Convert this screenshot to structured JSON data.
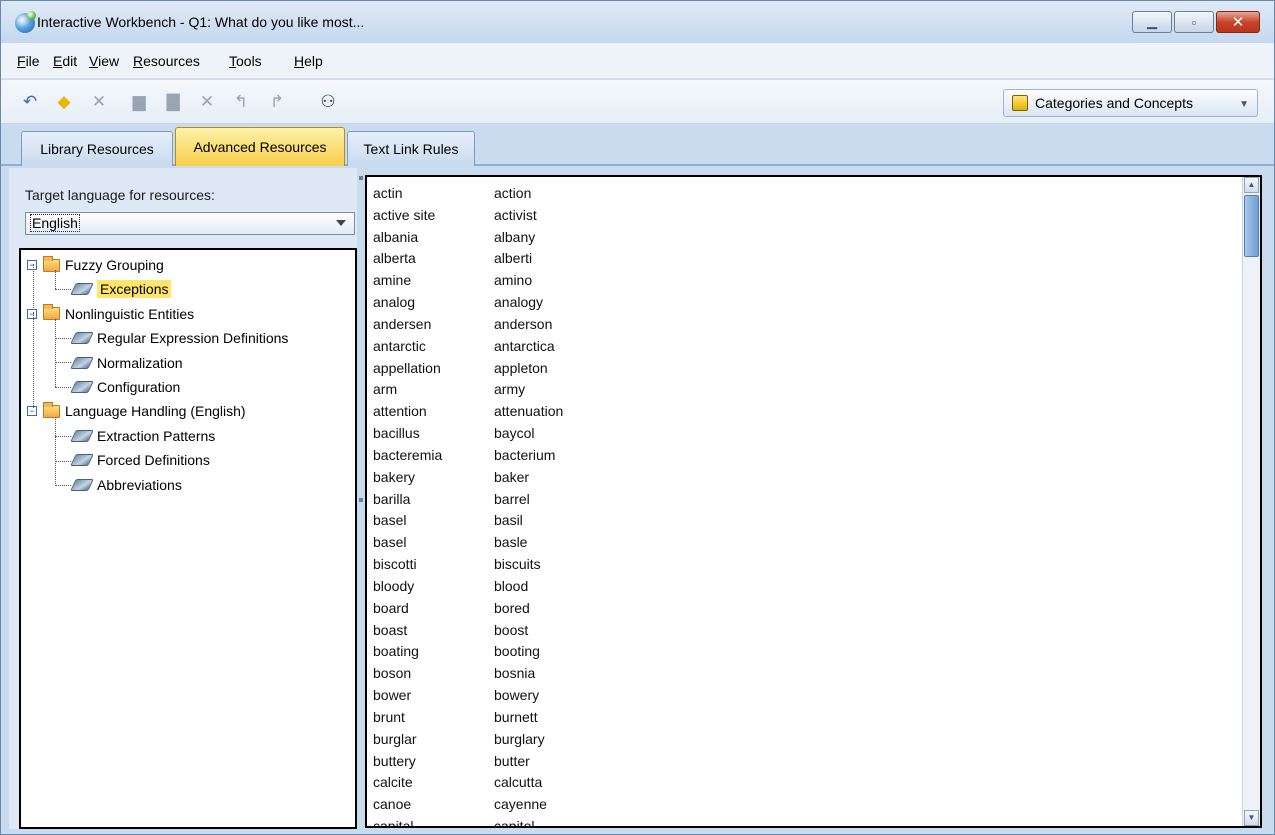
{
  "window": {
    "title": "Interactive Workbench - Q1: What do you like most..."
  },
  "menu": {
    "items": [
      {
        "label": "File",
        "mnemonic": "F",
        "rest": "ile"
      },
      {
        "label": "Edit",
        "mnemonic": "E",
        "rest": "dit"
      },
      {
        "label": "View",
        "mnemonic": "V",
        "rest": "iew"
      },
      {
        "label": "Resources",
        "mnemonic": "R",
        "rest": "esources"
      },
      {
        "label": "Tools",
        "mnemonic": "T",
        "rest": "ools"
      },
      {
        "label": "Help",
        "mnemonic": "H",
        "rest": "elp"
      }
    ]
  },
  "toolbar": {
    "icons": [
      "new-icon",
      "add-diamond-icon",
      "cut-icon",
      "copy-icon",
      "paste-icon",
      "delete-icon",
      "undo-icon",
      "redo-icon",
      "find-binoculars-icon"
    ],
    "categories_button": "Categories and Concepts"
  },
  "tabs": [
    {
      "label": "Library Resources",
      "active": false
    },
    {
      "label": "Advanced Resources",
      "active": true
    },
    {
      "label": "Text Link Rules",
      "active": false
    }
  ],
  "left": {
    "target_label": "Target language for resources:",
    "language": "English",
    "tree": [
      {
        "label": "Fuzzy Grouping",
        "type": "folder",
        "level": 0
      },
      {
        "label": "Exceptions",
        "type": "item",
        "level": 1,
        "selected": true
      },
      {
        "label": "Nonlinguistic Entities",
        "type": "folder",
        "level": 0
      },
      {
        "label": "Regular Expression Definitions",
        "type": "item",
        "level": 1
      },
      {
        "label": "Normalization",
        "type": "item",
        "level": 1
      },
      {
        "label": "Configuration",
        "type": "item",
        "level": 1
      },
      {
        "label": "Language Handling (English)",
        "type": "folder",
        "level": 0
      },
      {
        "label": "Extraction Patterns",
        "type": "item",
        "level": 1
      },
      {
        "label": "Forced Definitions",
        "type": "item",
        "level": 1
      },
      {
        "label": "Abbreviations",
        "type": "item",
        "level": 1
      }
    ]
  },
  "words": [
    [
      "actin",
      "action"
    ],
    [
      "active site",
      "activist"
    ],
    [
      "albania",
      "albany"
    ],
    [
      "alberta",
      "alberti"
    ],
    [
      "amine",
      "amino"
    ],
    [
      "analog",
      "analogy"
    ],
    [
      "andersen",
      "anderson"
    ],
    [
      "antarctic",
      "antarctica"
    ],
    [
      "appellation",
      "appleton"
    ],
    [
      "arm",
      "army"
    ],
    [
      "attention",
      "attenuation"
    ],
    [
      "bacillus",
      "baycol"
    ],
    [
      "bacteremia",
      "bacterium"
    ],
    [
      "bakery",
      "baker"
    ],
    [
      "barilla",
      "barrel"
    ],
    [
      "basel",
      "basil"
    ],
    [
      "basel",
      "basle"
    ],
    [
      "biscotti",
      "biscuits"
    ],
    [
      "bloody",
      "blood"
    ],
    [
      "board",
      "bored"
    ],
    [
      "boast",
      "boost"
    ],
    [
      "boating",
      "booting"
    ],
    [
      "boson",
      "bosnia"
    ],
    [
      "bower",
      "bowery"
    ],
    [
      "brunt",
      "burnett"
    ],
    [
      "burglar",
      "burglary"
    ],
    [
      "buttery",
      "butter"
    ],
    [
      "calcite",
      "calcutta"
    ],
    [
      "canoe",
      "cayenne"
    ],
    [
      "capital",
      "capitol"
    ]
  ]
}
